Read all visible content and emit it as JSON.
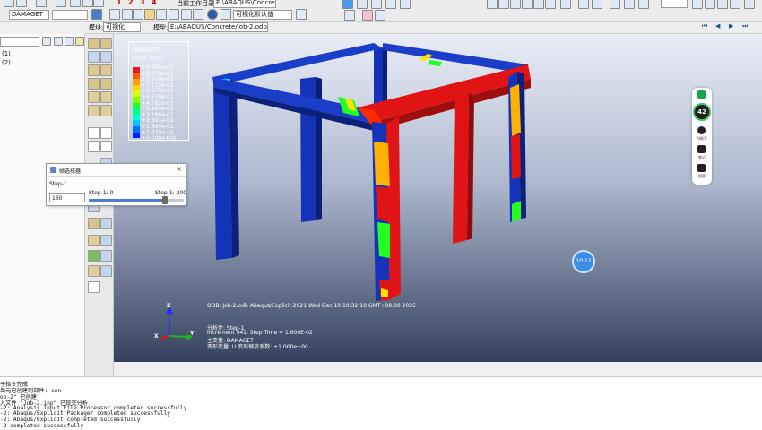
{
  "toolbar": {
    "variable_combo": "DAMAGET",
    "work_dir_label": "当前工作目录:",
    "work_dir_value": "E:\\ABAQUS\\Concrete",
    "display_group_combo": "可视化默认值",
    "numbers": [
      "1",
      "2",
      "3",
      "4"
    ]
  },
  "module_bar": {
    "module_label": "模块:",
    "module_value": "可视化",
    "model_label": "模型:",
    "model_value": "E:/ABAQUS/Concrete/Job-2.odb"
  },
  "tree": {
    "items": [
      "(1)",
      "(2)"
    ]
  },
  "legend": {
    "title": "DAMAGET",
    "subtitle": "(平均: 75%)",
    "values": [
      "+9.565e-01",
      "+8.768e-01",
      "+7.970e-01",
      "+7.173e-01",
      "+6.376e-01",
      "+5.579e-01",
      "+4.782e-01",
      "+3.985e-01",
      "+3.188e-01",
      "+2.391e-01",
      "+1.594e-01",
      "+7.970e-02",
      "+0.000e+00"
    ],
    "colors": [
      "#e41b1b",
      "#ff5a00",
      "#ffa000",
      "#ffd200",
      "#d8ff00",
      "#86ff00",
      "#20ff20",
      "#00ff84",
      "#00ffd6",
      "#00c8ff",
      "#0070ff",
      "#0020ff",
      "#0000c8"
    ]
  },
  "viewport_info": {
    "odb_line": "ODB: Job-2.odb    Abaqus/Explicit 2021    Wed Dec 10 10:32:10 GMT+08:00 2025",
    "step_line": "分析步: Step-1",
    "increment_line": "Increment     941: Step Time =    1.600E-02",
    "primary_var": "主变量: DAMAGET",
    "deform_var": "变形变量: U  变形缩放系数: +1.000e+00"
  },
  "axes": {
    "x": "X",
    "y": "Y",
    "z": "Z"
  },
  "probe_dialog": {
    "title": "帧选择器",
    "step_label": "Step-1",
    "frame_value": "160",
    "min_label": "Step-1: 0",
    "max_label": "Step-1: 200",
    "close_glyph": "×"
  },
  "float_bar": {
    "percent": "42",
    "item1": "AI助手",
    "item2": "笔记",
    "item3": "搜索"
  },
  "badge": {
    "text": "10:12"
  },
  "messages": [
    "予指令完成",
    "单元已创建到部件: con",
    "ob-2\" 已创建",
    "入文件 \"Job-2.inp\" 已提交分析",
    "-2: Analysis Input File Processor completed successfully",
    "-2: Abaqus/Explicit Packager completed successfully",
    "-2: Abaqus/Explicit completed successfully",
    "-2 completed successfully"
  ]
}
